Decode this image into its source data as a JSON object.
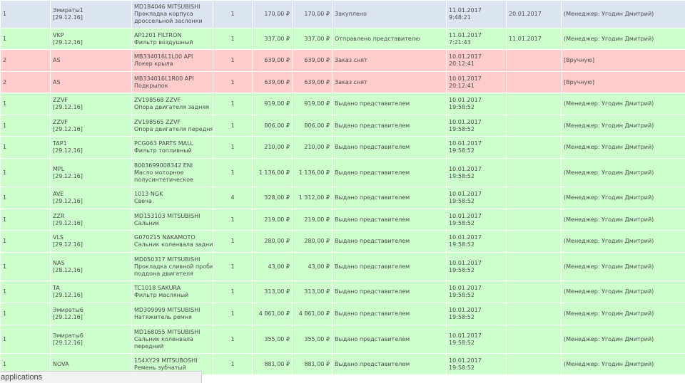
{
  "rows": [
    {
      "style": "blue",
      "h": 39,
      "num": "1",
      "supplier": "Эмираты1",
      "supplier_date": "[29.12.16]",
      "part_code": "MD184046",
      "part_brand": "MITSUBISHI",
      "part_code_link": false,
      "desc": [
        "Прокладка корпуса",
        "дроссельной заслонки"
      ],
      "qty": "1",
      "price": "170,00 ₽",
      "sum": "170,00 ₽",
      "status": "Закуплено",
      "date1": "11.01.2017",
      "time1": "9:48:21",
      "date2": "20.01.2017",
      "manager": "(Менеджер: Угодин Дмитрий)"
    },
    {
      "style": "green",
      "h": 30,
      "num": "1",
      "supplier": "VKP",
      "supplier_date": "[29.12.16]",
      "part_code": "AP1201",
      "part_brand": "FILTRON",
      "part_code_link": false,
      "desc": [
        "Фильтр воздушный"
      ],
      "qty": "1",
      "price": "337,00 ₽",
      "sum": "337,00 ₽",
      "status": "Отправлено представителю",
      "date1": "11.01.2017",
      "time1": "7:21:43",
      "date2": "11.01.2017",
      "manager": "(Менеджер: Угодин Дмитрий)"
    },
    {
      "style": "red",
      "h": 31,
      "num": "2",
      "supplier": "AS",
      "supplier_date": "",
      "part_code": "MB334016L1L00",
      "part_brand": "API",
      "part_code_link": true,
      "desc": [
        "Локер крыла"
      ],
      "qty": "1",
      "price": "639,00 ₽",
      "sum": "639,00 ₽",
      "status": "Заказ снят",
      "date1": "10.01.2017",
      "time1": "20:12:41",
      "date2": "",
      "manager": "[Вручную]"
    },
    {
      "style": "red",
      "h": 30,
      "num": "2",
      "supplier": "AS",
      "supplier_date": "",
      "part_code": "MB334016L1R00",
      "part_brand": "API",
      "part_code_link": true,
      "desc": [
        "Подкрылок"
      ],
      "qty": "1",
      "price": "639,00 ₽",
      "sum": "639,00 ₽",
      "status": "Заказ снят",
      "date1": "10.01.2017",
      "time1": "20:12:41",
      "date2": "",
      "manager": "[Вручную]"
    },
    {
      "style": "green",
      "h": 31,
      "num": "1",
      "supplier": "ZZVF",
      "supplier_date": "[29.12.16]",
      "part_code": "ZV198568",
      "part_brand": "ZZVF",
      "part_code_link": false,
      "desc": [
        "Опора двигателя задняя"
      ],
      "qty": "1",
      "price": "919,00 ₽",
      "sum": "919,00 ₽",
      "status": "Выдано представителем",
      "date1": "10.01.2017",
      "time1": "19:58:52",
      "date2": "",
      "manager": "(Менеджер: Угодин Дмитрий)"
    },
    {
      "style": "green",
      "h": 30,
      "num": "1",
      "supplier": "ZZVF",
      "supplier_date": "[29.12.16]",
      "part_code": "ZV198565",
      "part_brand": "ZZVF",
      "part_code_link": false,
      "desc": [
        "Опора двигателя передняя"
      ],
      "qty": "1",
      "price": "806,00 ₽",
      "sum": "806,00 ₽",
      "status": "Выдано представителем",
      "date1": "10.01.2017",
      "time1": "19:58:52",
      "date2": "",
      "manager": "(Менеджер: Угодин Дмитрий)"
    },
    {
      "style": "green",
      "h": 31,
      "num": "1",
      "supplier": "TAP1",
      "supplier_date": "[29.12.16]",
      "part_code": "PCG063",
      "part_brand": "PARTS MALL",
      "part_code_link": false,
      "desc": [
        "Фильтр топливный"
      ],
      "qty": "1",
      "price": "210,00 ₽",
      "sum": "210,00 ₽",
      "status": "Выдано представителем",
      "date1": "10.01.2017",
      "time1": "19:58:52",
      "date2": "",
      "manager": "(Менеджер: Угодин Дмитрий)"
    },
    {
      "style": "green",
      "h": 40,
      "num": "1",
      "supplier": "MPL",
      "supplier_date": "[29.12.16]",
      "part_code": "8003699008342",
      "part_brand": "ENI",
      "part_code_link": false,
      "desc": [
        "Масло моторное",
        "полусинтетическое"
      ],
      "qty": "1",
      "price": "1 136,00 ₽",
      "sum": "1 136,00 ₽",
      "status": "Выдано представителем",
      "date1": "10.01.2017",
      "time1": "19:58:52",
      "date2": "",
      "manager": "(Менеджер: Угодин Дмитрий)"
    },
    {
      "style": "green",
      "h": 31,
      "num": "1",
      "supplier": "AVE",
      "supplier_date": "[29.12.16]",
      "part_code": "1013",
      "part_brand": "NGK",
      "part_code_link": false,
      "desc": [
        "Свеча"
      ],
      "qty": "4",
      "price": "328,00 ₽",
      "sum": "1 312,00 ₽",
      "status": "Выдано представителем",
      "date1": "10.01.2017",
      "time1": "19:58:52",
      "date2": "",
      "manager": "(Менеджер: Угодин Дмитрий)"
    },
    {
      "style": "green",
      "h": 30,
      "num": "1",
      "supplier": "ZZR",
      "supplier_date": "[29.12.16]",
      "part_code": "MD153103",
      "part_brand": "MITSUBISHI",
      "part_code_link": false,
      "desc": [
        "Сальник"
      ],
      "qty": "1",
      "price": "219,00 ₽",
      "sum": "219,00 ₽",
      "status": "Выдано представителем",
      "date1": "10.01.2017",
      "time1": "19:58:52",
      "date2": "",
      "manager": "(Менеджер: Угодин Дмитрий)"
    },
    {
      "style": "green",
      "h": 31,
      "num": "1",
      "supplier": "VLS",
      "supplier_date": "[29.12.16]",
      "part_code": "G070215",
      "part_brand": "NAKAMOTO",
      "part_code_link": false,
      "desc": [
        "Сальник коленвала задний"
      ],
      "qty": "1",
      "price": "280,00 ₽",
      "sum": "280,00 ₽",
      "status": "Выдано представителем",
      "date1": "10.01.2017",
      "time1": "19:58:52",
      "date2": "",
      "manager": "(Менеджер: Угодин Дмитрий)"
    },
    {
      "style": "green",
      "h": 40,
      "num": "1",
      "supplier": "NAS",
      "supplier_date": "[28.12.16]",
      "part_code": "MD050317",
      "part_brand": "MITSUBISHI",
      "part_code_link": false,
      "desc": [
        "Прокладка сливной пробки",
        "поддона двигателя"
      ],
      "qty": "1",
      "price": "43,00 ₽",
      "sum": "43,00 ₽",
      "status": "Выдано представителем",
      "date1": "10.01.2017",
      "time1": "19:58:52",
      "date2": "",
      "manager": "(Менеджер: Угодин Дмитрий)"
    },
    {
      "style": "green",
      "h": 31,
      "num": "1",
      "supplier": "TA",
      "supplier_date": "[29.12.16]",
      "part_code": "TC1018",
      "part_brand": "SAKURA",
      "part_code_link": false,
      "desc": [
        "Фильтр масляный"
      ],
      "qty": "1",
      "price": "313,00 ₽",
      "sum": "313,00 ₽",
      "status": "Выдано представителем",
      "date1": "10.01.2017",
      "time1": "19:58:52",
      "date2": "",
      "manager": "(Менеджер: Угодин Дмитрий)"
    },
    {
      "style": "green",
      "h": 31,
      "num": "1",
      "supplier": "Эмираты6",
      "supplier_date": "[29.12.16]",
      "part_code": "MD309999",
      "part_brand": "MITSUBISHI",
      "part_code_link": false,
      "desc": [
        "Натяжитель ремня"
      ],
      "qty": "1",
      "price": "4 861,00 ₽",
      "sum": "4 861,00 ₽",
      "status": "Выдано представителем",
      "date1": "10.01.2017",
      "time1": "19:58:52",
      "date2": "",
      "manager": "(Менеджер: Угодин Дмитрий)"
    },
    {
      "style": "green",
      "h": 40,
      "num": "1",
      "supplier": "Эмираты6",
      "supplier_date": "[29.12.16]",
      "part_code": "MD168055",
      "part_brand": "MITSUBISHI",
      "part_code_link": false,
      "desc": [
        "Сальник коленвала",
        "передний"
      ],
      "qty": "1",
      "price": "355,00 ₽",
      "sum": "355,00 ₽",
      "status": "Выдано представителем",
      "date1": "10.01.2017",
      "time1": "19:58:52",
      "date2": "",
      "manager": "(Менеджер: Угодин Дмитрий)"
    },
    {
      "style": "green",
      "h": 30,
      "num": "1",
      "supplier": "NOVA",
      "supplier_date": "",
      "part_code": "154XY29",
      "part_brand": "MITSUBOSHI",
      "part_code_link": false,
      "desc": [
        "Ремень зубчатый"
      ],
      "qty": "1",
      "price": "881,00 ₽",
      "sum": "881,00 ₽",
      "status": "Выдано представителем",
      "date1": "10.01.2017",
      "time1": "19:58:52",
      "date2": "",
      "manager": "(Менеджер: Угодин Дмитрий)"
    }
  ],
  "statusbar": {
    "text": "applications"
  }
}
